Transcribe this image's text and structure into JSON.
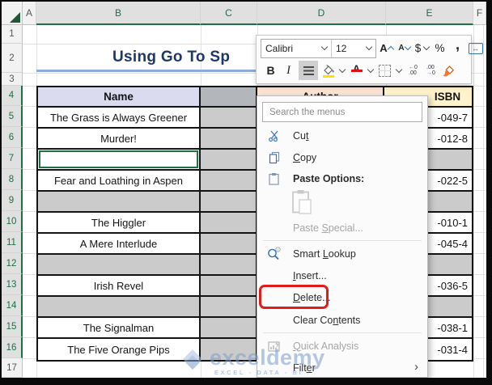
{
  "sheet": {
    "columns": [
      {
        "label": "A",
        "selected": false
      },
      {
        "label": "B",
        "selected": true
      },
      {
        "label": "C",
        "selected": true
      },
      {
        "label": "D",
        "selected": true
      },
      {
        "label": "E",
        "selected": true
      },
      {
        "label": "F",
        "selected": false
      }
    ],
    "rows": [
      {
        "n": "1",
        "selected": false
      },
      {
        "n": "2",
        "selected": false
      },
      {
        "n": "3",
        "selected": false
      },
      {
        "n": "4",
        "selected": true
      },
      {
        "n": "5",
        "selected": true
      },
      {
        "n": "6",
        "selected": true
      },
      {
        "n": "7",
        "selected": true
      },
      {
        "n": "8",
        "selected": true
      },
      {
        "n": "9",
        "selected": true
      },
      {
        "n": "10",
        "selected": true
      },
      {
        "n": "11",
        "selected": true
      },
      {
        "n": "12",
        "selected": true
      },
      {
        "n": "13",
        "selected": true
      },
      {
        "n": "14",
        "selected": true
      },
      {
        "n": "15",
        "selected": true
      },
      {
        "n": "16",
        "selected": true
      },
      {
        "n": "17",
        "selected": false
      }
    ]
  },
  "title": {
    "text": "Using Go To Sp"
  },
  "table": {
    "headers": [
      {
        "label": "Name",
        "fill": "#DBDBF0"
      },
      {
        "label": "",
        "fill": "#B3B6BB"
      },
      {
        "label": "Author",
        "fill": "#FBE3D4"
      },
      {
        "label": "ISBN",
        "fill": "#FFF2CC"
      }
    ],
    "rows": [
      {
        "row": "5",
        "name": "The Grass is Always Greener",
        "isbn": "-049-7",
        "blank": false,
        "active": false
      },
      {
        "row": "6",
        "name": "Murder!",
        "isbn": "-012-8",
        "blank": false,
        "active": false
      },
      {
        "row": "7",
        "name": "",
        "isbn": "",
        "blank": true,
        "active": true
      },
      {
        "row": "8",
        "name": "Fear and Loathing in Aspen",
        "isbn": "-022-5",
        "blank": false,
        "active": false
      },
      {
        "row": "9",
        "name": "",
        "isbn": "",
        "blank": true,
        "active": false
      },
      {
        "row": "10",
        "name": "The Higgler",
        "isbn": "-010-1",
        "blank": false,
        "active": false
      },
      {
        "row": "11",
        "name": "A Mere Interlude",
        "isbn": "-045-4",
        "blank": false,
        "active": false
      },
      {
        "row": "12",
        "name": "",
        "isbn": "",
        "blank": true,
        "active": false
      },
      {
        "row": "13",
        "name": "Irish Revel",
        "isbn": "-036-5",
        "blank": false,
        "active": false
      },
      {
        "row": "14",
        "name": "",
        "isbn": "",
        "blank": true,
        "active": false
      },
      {
        "row": "15",
        "name": "The Signalman",
        "isbn": "-038-1",
        "blank": false,
        "active": false
      },
      {
        "row": "16",
        "name": "The Five Orange Pips",
        "isbn": "-031-4",
        "blank": false,
        "active": false
      }
    ]
  },
  "toolbar": {
    "font_name": "Calibri",
    "font_size": "12",
    "grow_label": "A",
    "shrink_label": "A",
    "dollar_label": "$",
    "percent_label": "%",
    "comma_label": ",",
    "width_arrow": "↔",
    "bold_label": "B",
    "italic_label": "I",
    "font_color_label": "A",
    "dec_top": "←0",
    "dec_bottom": ".00",
    "inc_top": ".00",
    "inc_bottom": "→0"
  },
  "menu": {
    "search_placeholder": "Search the menus",
    "items": [
      {
        "pre": "Cu",
        "key": "t",
        "post": ""
      },
      {
        "pre": "",
        "key": "C",
        "post": "opy"
      },
      {
        "pre": "Paste Options:",
        "key": "",
        "post": ""
      },
      {
        "pre": "Paste ",
        "key": "S",
        "post": "pecial..."
      },
      {
        "pre": "Smart ",
        "key": "L",
        "post": "ookup"
      },
      {
        "pre": "",
        "key": "I",
        "post": "nsert..."
      },
      {
        "pre": "",
        "key": "D",
        "post": "elete..."
      },
      {
        "pre": "Clear Co",
        "key": "n",
        "post": "tents"
      },
      {
        "pre": "",
        "key": "Q",
        "post": "uick Analysis"
      },
      {
        "pre": "Filt",
        "key": "e",
        "post": "r"
      }
    ]
  },
  "watermark": {
    "brand": "exceldemy",
    "tagline": "EXCEL - DATA - BI"
  },
  "colors": {
    "accent_green": "#217346",
    "selection_gray": "#CBCBCB",
    "highlight_red": "#E21B1B",
    "title_blue": "#1F3864",
    "underline_blue": "#8FAADC",
    "name_header_fill": "#DBDBF0",
    "author_header_fill": "#FBE3D4",
    "isbn_header_fill": "#FFF2CC"
  }
}
